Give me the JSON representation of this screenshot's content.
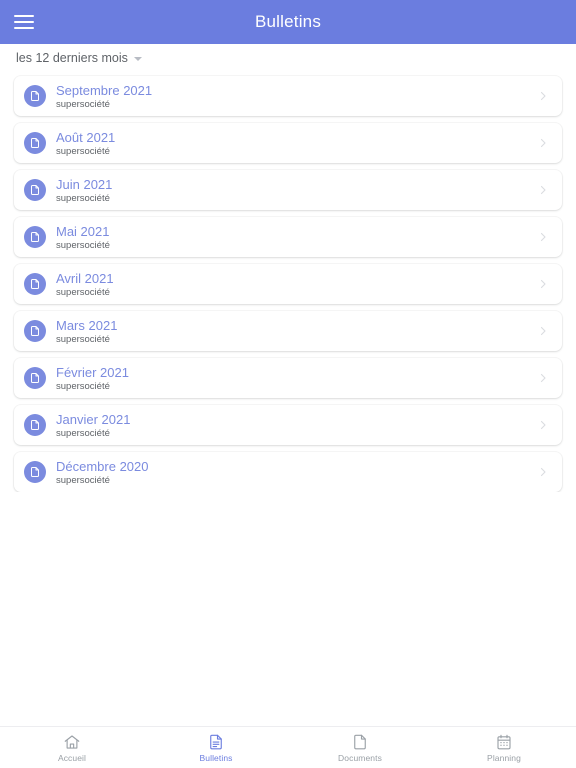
{
  "app_bar": {
    "title": "Bulletins",
    "menu_icon": "hamburger-menu-icon",
    "background_color": "#6b7ddf",
    "title_color": "#ffffff"
  },
  "filter": {
    "label": "les 12 derniers mois",
    "caret_icon": "caret-down-icon"
  },
  "list": {
    "item_icon": "document-icon",
    "chevron_icon": "chevron-right-icon",
    "accent_color": "#7b8bdf",
    "items": [
      {
        "title": "Septembre 2021",
        "subtitle": "supersociété"
      },
      {
        "title": "Août 2021",
        "subtitle": "supersociété"
      },
      {
        "title": "Juin 2021",
        "subtitle": "supersociété"
      },
      {
        "title": "Mai 2021",
        "subtitle": "supersociété"
      },
      {
        "title": "Avril 2021",
        "subtitle": "supersociété"
      },
      {
        "title": "Mars 2021",
        "subtitle": "supersociété"
      },
      {
        "title": "Février 2021",
        "subtitle": "supersociété"
      },
      {
        "title": "Janvier 2021",
        "subtitle": "supersociété"
      },
      {
        "title": "Décembre 2020",
        "subtitle": "supersociété"
      }
    ]
  },
  "bottom_nav": {
    "active_color": "#6b7ddf",
    "inactive_color": "#9aa0a6",
    "items": [
      {
        "label": "Accueil",
        "icon": "home-icon",
        "active": false
      },
      {
        "label": "Bulletins",
        "icon": "document-lines-icon",
        "active": true
      },
      {
        "label": "Documents",
        "icon": "page-icon",
        "active": false
      },
      {
        "label": "Planning",
        "icon": "calendar-icon",
        "active": false
      }
    ]
  }
}
